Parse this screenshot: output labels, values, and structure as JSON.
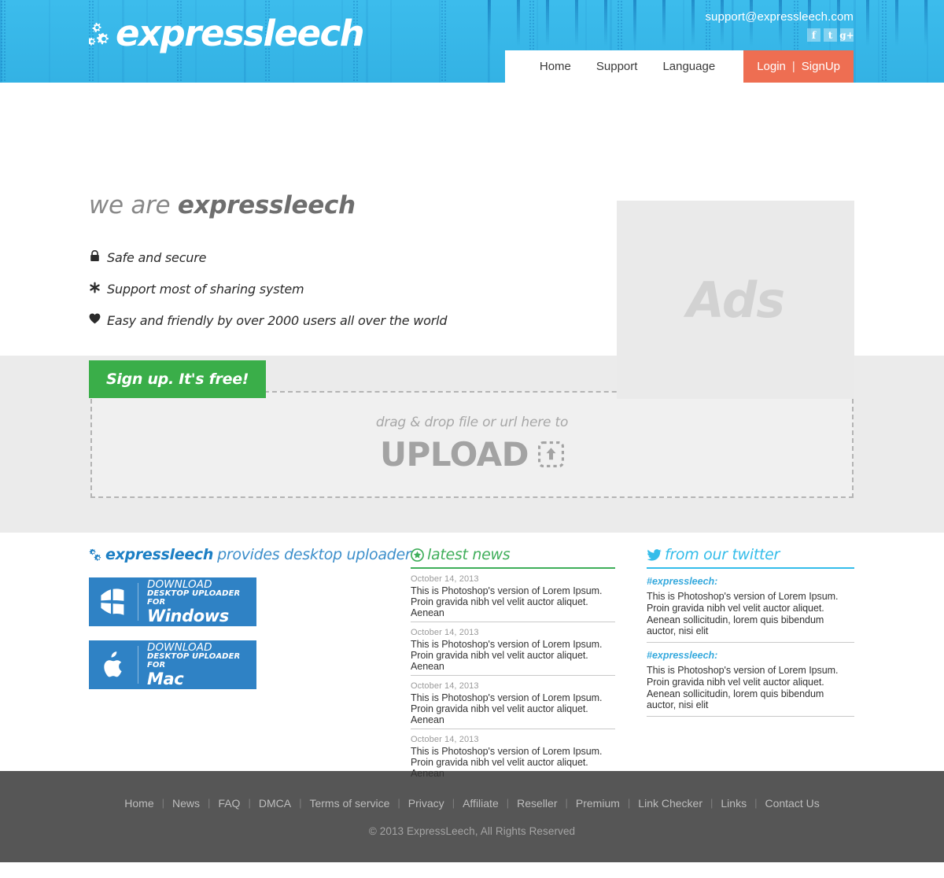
{
  "header": {
    "logo_text": "expressleech",
    "logo_icon": "gears-icon",
    "support_email": "support@expressleech.com",
    "social": [
      {
        "name": "facebook-icon",
        "glyph": "f"
      },
      {
        "name": "twitter-icon",
        "glyph": "t"
      },
      {
        "name": "googleplus-icon",
        "glyph": "g+"
      }
    ],
    "nav": [
      {
        "label": "Home"
      },
      {
        "label": "Support"
      },
      {
        "label": "Language"
      }
    ],
    "auth": {
      "login": "Login",
      "separator": "|",
      "signup": "SignUp"
    },
    "colors": {
      "background": "#37b7e8",
      "auth_button": "#ee6e52"
    }
  },
  "hero": {
    "title_prefix": "we are ",
    "title_brand": "expressleech",
    "features": [
      {
        "icon": "lock-icon",
        "glyph": "ὑ2",
        "text": "Safe and secure"
      },
      {
        "icon": "asterisk-icon",
        "glyph": "✱",
        "text": "Support most of sharing system"
      },
      {
        "icon": "heart-icon",
        "glyph": "♥",
        "text": "Easy and friendly by over 2000 users all over the world"
      }
    ],
    "signup_button": "Sign up. It's free!",
    "signup_color": "#3aae49",
    "ads_label": "Ads"
  },
  "upload": {
    "sub_label": "drag & drop file or url here to",
    "main_label": "UPLOAD",
    "icon": "upload-arrow-icon"
  },
  "uploader_section": {
    "heading_brand": "expressleech",
    "heading_rest": "provides desktop uploader",
    "heading_icon": "gears-icon",
    "buttons": [
      {
        "icon": "windows-logo-icon",
        "line1": "DOWNLOAD",
        "line2": "DESKTOP UPLOADER FOR",
        "line3": "Windows"
      },
      {
        "icon": "apple-logo-icon",
        "line1": "DOWNLOAD",
        "line2": "DESKTOP UPLOADER FOR",
        "line3": "Mac"
      }
    ]
  },
  "news_section": {
    "heading": "latest news",
    "heading_icon": "circled-star-icon",
    "accent": "#3fae5a",
    "items": [
      {
        "date": "October 14, 2013",
        "body": "This is Photoshop's version  of Lorem Ipsum. Proin gravida nibh vel velit auctor aliquet. Aenean"
      },
      {
        "date": "October 14, 2013",
        "body": "This is Photoshop's version  of Lorem Ipsum. Proin gravida nibh vel velit auctor aliquet. Aenean"
      },
      {
        "date": "October 14, 2013",
        "body": "This is Photoshop's version  of Lorem Ipsum. Proin gravida nibh vel velit auctor aliquet. Aenean"
      },
      {
        "date": "October 14, 2013",
        "body": "This is Photoshop's version  of Lorem Ipsum. Proin gravida nibh vel velit auctor aliquet. Aenean"
      }
    ]
  },
  "twitter_section": {
    "heading": "from our twitter",
    "heading_icon": "twitter-bird-icon",
    "accent": "#35bdea",
    "items": [
      {
        "handle": "#expressleech:",
        "body": "This is Photoshop's version  of Lorem Ipsum. Proin gravida nibh vel velit auctor aliquet. Aenean sollicitudin, lorem quis bibendum auctor, nisi elit"
      },
      {
        "handle": "#expressleech:",
        "body": "This is Photoshop's version  of Lorem Ipsum. Proin gravida nibh vel velit auctor aliquet. Aenean sollicitudin, lorem quis bibendum auctor, nisi elit"
      }
    ]
  },
  "footer": {
    "links": [
      "Home",
      "News",
      "FAQ",
      "DMCA",
      "Terms of service",
      "Privacy",
      "Affiliate",
      "Reseller",
      "Premium",
      "Link Checker",
      "Links",
      "Contact Us"
    ],
    "copyright": "© 2013 ExpressLeech, All Rights Reserved",
    "background": "#565656"
  }
}
